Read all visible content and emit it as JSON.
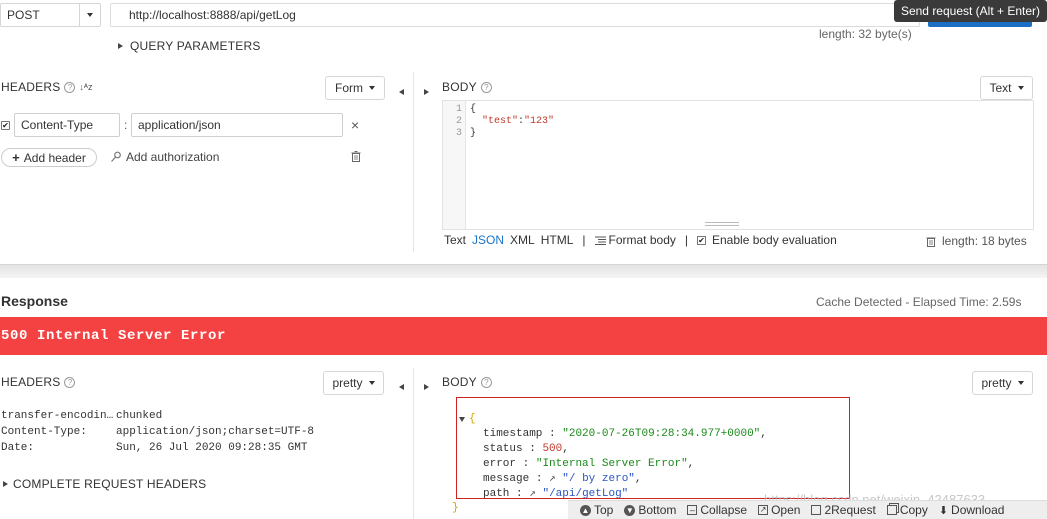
{
  "request": {
    "method": "POST",
    "url": "http://localhost:8888/api/getLog",
    "send_tooltip": "Send request (Alt + Enter)",
    "length": "length: 32 byte(s)",
    "query_params_label": "QUERY PARAMETERS"
  },
  "req_headers": {
    "title": "HEADERS",
    "sort_glyph": "↓ᴬz",
    "mode": "Form",
    "header_name": "Content-Type",
    "header_colon": ":",
    "header_value": "application/json",
    "remove_glyph": "×",
    "add_header": "Add header",
    "add_auth": "Add authorization"
  },
  "req_body": {
    "title": "BODY",
    "mode": "Text",
    "line_numbers": [
      "1",
      "2",
      "3"
    ],
    "code": {
      "open": "{",
      "key": "\"test\"",
      "colon": ":",
      "value": "\"123\"",
      "close": "}"
    },
    "formats": [
      "Text",
      "JSON",
      "XML",
      "HTML"
    ],
    "sep": "|",
    "format_body": "Format body",
    "enable_eval": "Enable body evaluation",
    "length": "length: 18 bytes"
  },
  "response": {
    "title": "Response",
    "cache_info": "Cache Detected - Elapsed Time: 2.59s",
    "status_banner": "500 Internal Server Error",
    "status_color": "#f44242",
    "headers_title": "HEADERS",
    "headers_mode": "pretty",
    "headers": [
      {
        "name": "transfer-encodin…",
        "value": "chunked"
      },
      {
        "name": "Content-Type:",
        "value": "application/json;charset=UTF-8"
      },
      {
        "name": "Date:",
        "value": "Sun, 26 Jul 2020 09:28:35 GMT"
      }
    ],
    "complete_headers": "COMPLETE REQUEST HEADERS",
    "body_title": "BODY",
    "body_mode": "pretty",
    "json": {
      "open": "{",
      "close": "}",
      "timestamp_key": "timestamp",
      "timestamp_val": "\"2020-07-26T09:28:34.977+0000\"",
      "status_key": "status",
      "status_val": "500",
      "error_key": "error",
      "error_val": "\"Internal Server Error\"",
      "message_key": "message",
      "message_val": "\"/ by zero\"",
      "path_key": "path",
      "path_val": "\"/api/getLog\"",
      "sep": ":",
      "comma": ","
    },
    "watermark": "https://blog.csdn.net/weixin_42487633",
    "toolbar": {
      "top": "Top",
      "bottom": "Bottom",
      "collapse": "Collapse",
      "open": "Open",
      "request2": "2Request",
      "copy": "Copy",
      "download": "Download"
    }
  },
  "colors": {
    "accent_blue": "#1a73c8",
    "highlight_box": "#cc2222"
  }
}
